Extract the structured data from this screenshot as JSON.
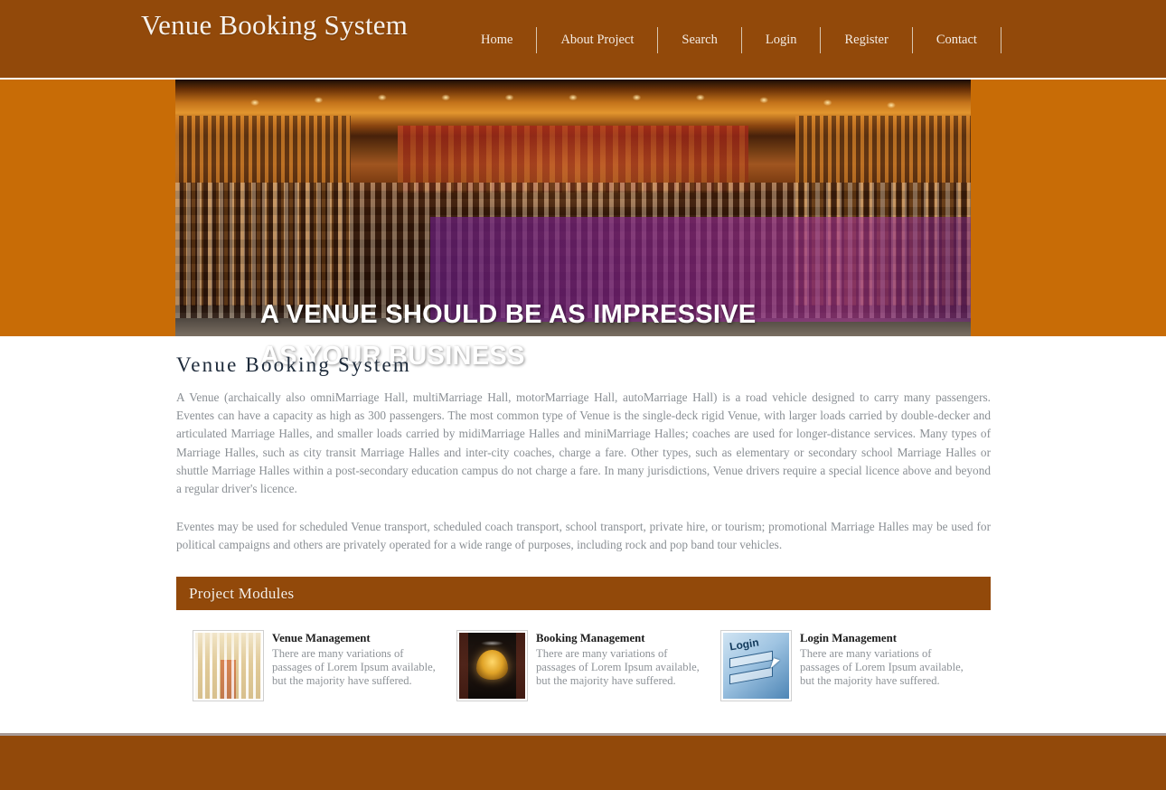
{
  "header": {
    "brand": "Venue Booking System",
    "nav": [
      {
        "label": "Home"
      },
      {
        "label": "About Project"
      },
      {
        "label": "Search"
      },
      {
        "label": "Login"
      },
      {
        "label": "Register"
      },
      {
        "label": "Contact"
      }
    ],
    "background_color": "#92490a"
  },
  "banner": {
    "band_color": "#c86c06",
    "overlay_color": "#86248c",
    "headline_line1": "A VENUE SHOULD BE AS IMPRESSIVE",
    "headline_line2": "AS YOUR BUSINESS",
    "image_alt": "auditorium-interior-photo"
  },
  "main": {
    "title": "Venue Booking System",
    "paragraph_1": "A Venue (archaically also omniMarriage Hall, multiMarriage Hall, motorMarriage Hall, autoMarriage Hall) is a road vehicle designed to carry many passengers. Eventes can have a capacity as high as 300 passengers. The most common type of Venue is the single-deck rigid Venue, with larger loads carried by double-decker and articulated Marriage Halles, and smaller loads carried by midiMarriage Halles and miniMarriage Halles; coaches are used for longer-distance services. Many types of Marriage Halles, such as city transit Marriage Halles and inter-city coaches, charge a fare. Other types, such as elementary or secondary school Marriage Halles or shuttle Marriage Halles within a post-secondary education campus do not charge a fare. In many jurisdictions, Venue drivers require a special licence above and beyond a regular driver's licence.",
    "paragraph_2": "Eventes may be used for scheduled Venue transport, scheduled coach transport, school transport, private hire, or tourism; promotional Marriage Halles may be used for political campaigns and others are privately operated for a wide range of purposes, including rock and pop band tour vehicles."
  },
  "modules": {
    "section_title": "Project Modules",
    "section_bar_color": "#92490a",
    "items": [
      {
        "title": "Venue Management",
        "description": "There are many variations of passages of Lorem Ipsum available, but the majority have suffered.",
        "thumb_alt": "banquet-hall-thumbnail"
      },
      {
        "title": "Booking Management",
        "description": "There are many variations of passages of Lorem Ipsum available, but the majority have suffered.",
        "thumb_alt": "venue-entrance-thumbnail"
      },
      {
        "title": "Login Management",
        "description": "There are many variations of passages of Lorem Ipsum available, but the majority have suffered.",
        "thumb_alt": "login-form-thumbnail",
        "thumb_caption": "Login"
      }
    ]
  },
  "footer": {
    "background_color": "#92490a",
    "border_color": "#a89a96"
  }
}
